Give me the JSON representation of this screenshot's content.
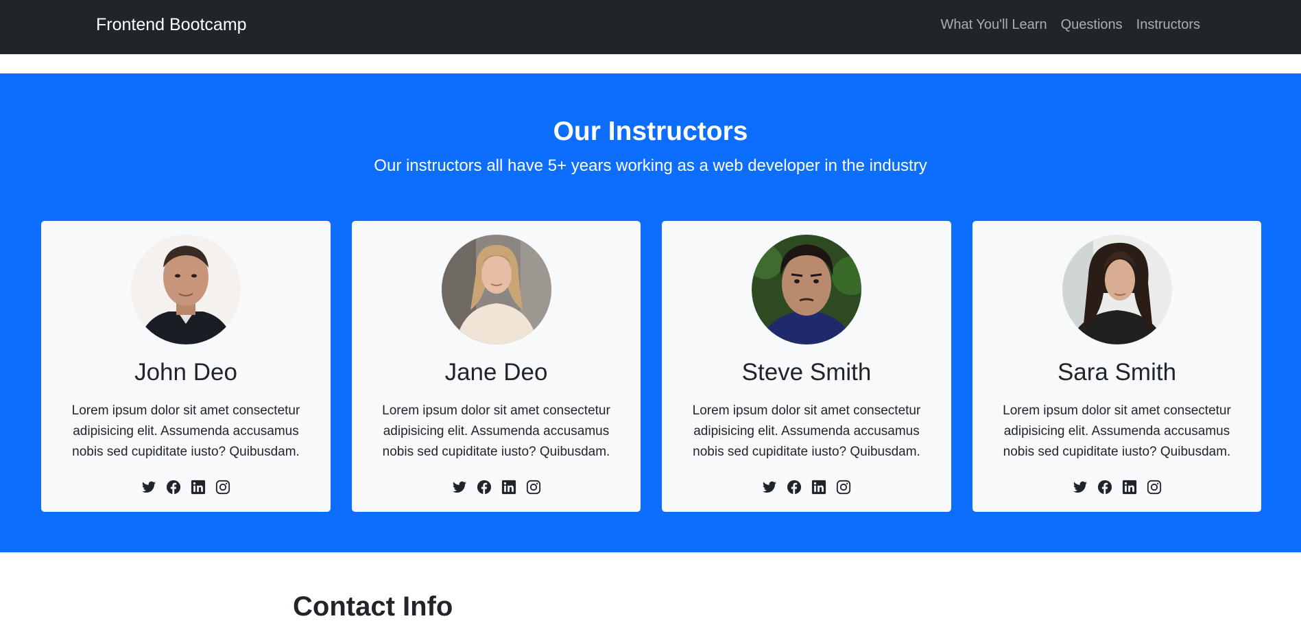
{
  "navbar": {
    "brand": "Frontend Bootcamp",
    "links": [
      "What You'll Learn",
      "Questions",
      "Instructors"
    ],
    "background": "#212529"
  },
  "instructors": {
    "title": "Our Instructors",
    "lead": "Our instructors all have 5+ years working as a web developer in the industry",
    "background": "#0d6efd",
    "cards": [
      {
        "name": "John Deo",
        "text": "Lorem ipsum dolor sit amet consectetur adipisicing elit. Assumenda accusamus nobis sed cupiditate iusto? Quibusdam.",
        "socials": [
          "twitter-icon",
          "facebook-icon",
          "linkedin-icon",
          "instagram-icon"
        ]
      },
      {
        "name": "Jane Deo",
        "text": "Lorem ipsum dolor sit amet consectetur adipisicing elit. Assumenda accusamus nobis sed cupiditate iusto? Quibusdam.",
        "socials": [
          "twitter-icon",
          "facebook-icon",
          "linkedin-icon",
          "instagram-icon"
        ]
      },
      {
        "name": "Steve Smith",
        "text": "Lorem ipsum dolor sit amet consectetur adipisicing elit. Assumenda accusamus nobis sed cupiditate iusto? Quibusdam.",
        "socials": [
          "twitter-icon",
          "facebook-icon",
          "linkedin-icon",
          "instagram-icon"
        ]
      },
      {
        "name": "Sara Smith",
        "text": "Lorem ipsum dolor sit amet consectetur adipisicing elit. Assumenda accusamus nobis sed cupiditate iusto? Quibusdam.",
        "socials": [
          "twitter-icon",
          "facebook-icon",
          "linkedin-icon",
          "instagram-icon"
        ]
      }
    ]
  },
  "next_section": {
    "heading_partial": "Contact Info"
  }
}
